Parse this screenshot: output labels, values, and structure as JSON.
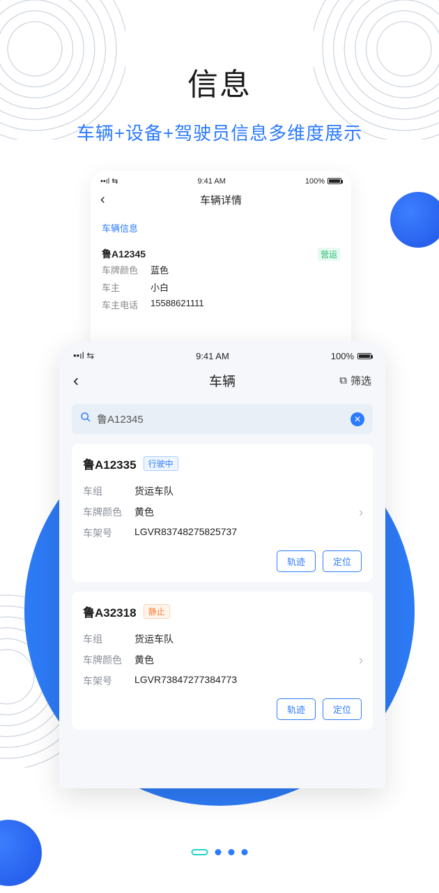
{
  "hero": {
    "title": "信息",
    "subtitle": "车辆+设备+驾驶员信息多维度展示"
  },
  "statusbar": {
    "time": "9:41 AM",
    "battery": "100%"
  },
  "detail": {
    "nav_title": "车辆详情",
    "section_title": "车辆信息",
    "plate": "鲁A12345",
    "status_badge": "营运",
    "rows": [
      {
        "label": "车牌颜色",
        "value": "蓝色"
      },
      {
        "label": "车主",
        "value": "小白"
      },
      {
        "label": "车主电话",
        "value": "15588621111"
      }
    ]
  },
  "list": {
    "nav_title": "车辆",
    "filter_label": "筛选",
    "search_value": "鲁A12345",
    "labels": {
      "group": "车组",
      "color": "车牌颜色",
      "vin": "车架号"
    },
    "buttons": {
      "track": "轨迹",
      "locate": "定位"
    },
    "status": {
      "driving": "行驶中",
      "stopped": "静止"
    },
    "items": [
      {
        "plate": "鲁A12335",
        "status_key": "driving",
        "group": "货运车队",
        "color": "黄色",
        "vin": "LGVR83748275825737"
      },
      {
        "plate": "鲁A32318",
        "status_key": "stopped",
        "group": "货运车队",
        "color": "黄色",
        "vin": "LGVR73847277384773"
      }
    ]
  }
}
